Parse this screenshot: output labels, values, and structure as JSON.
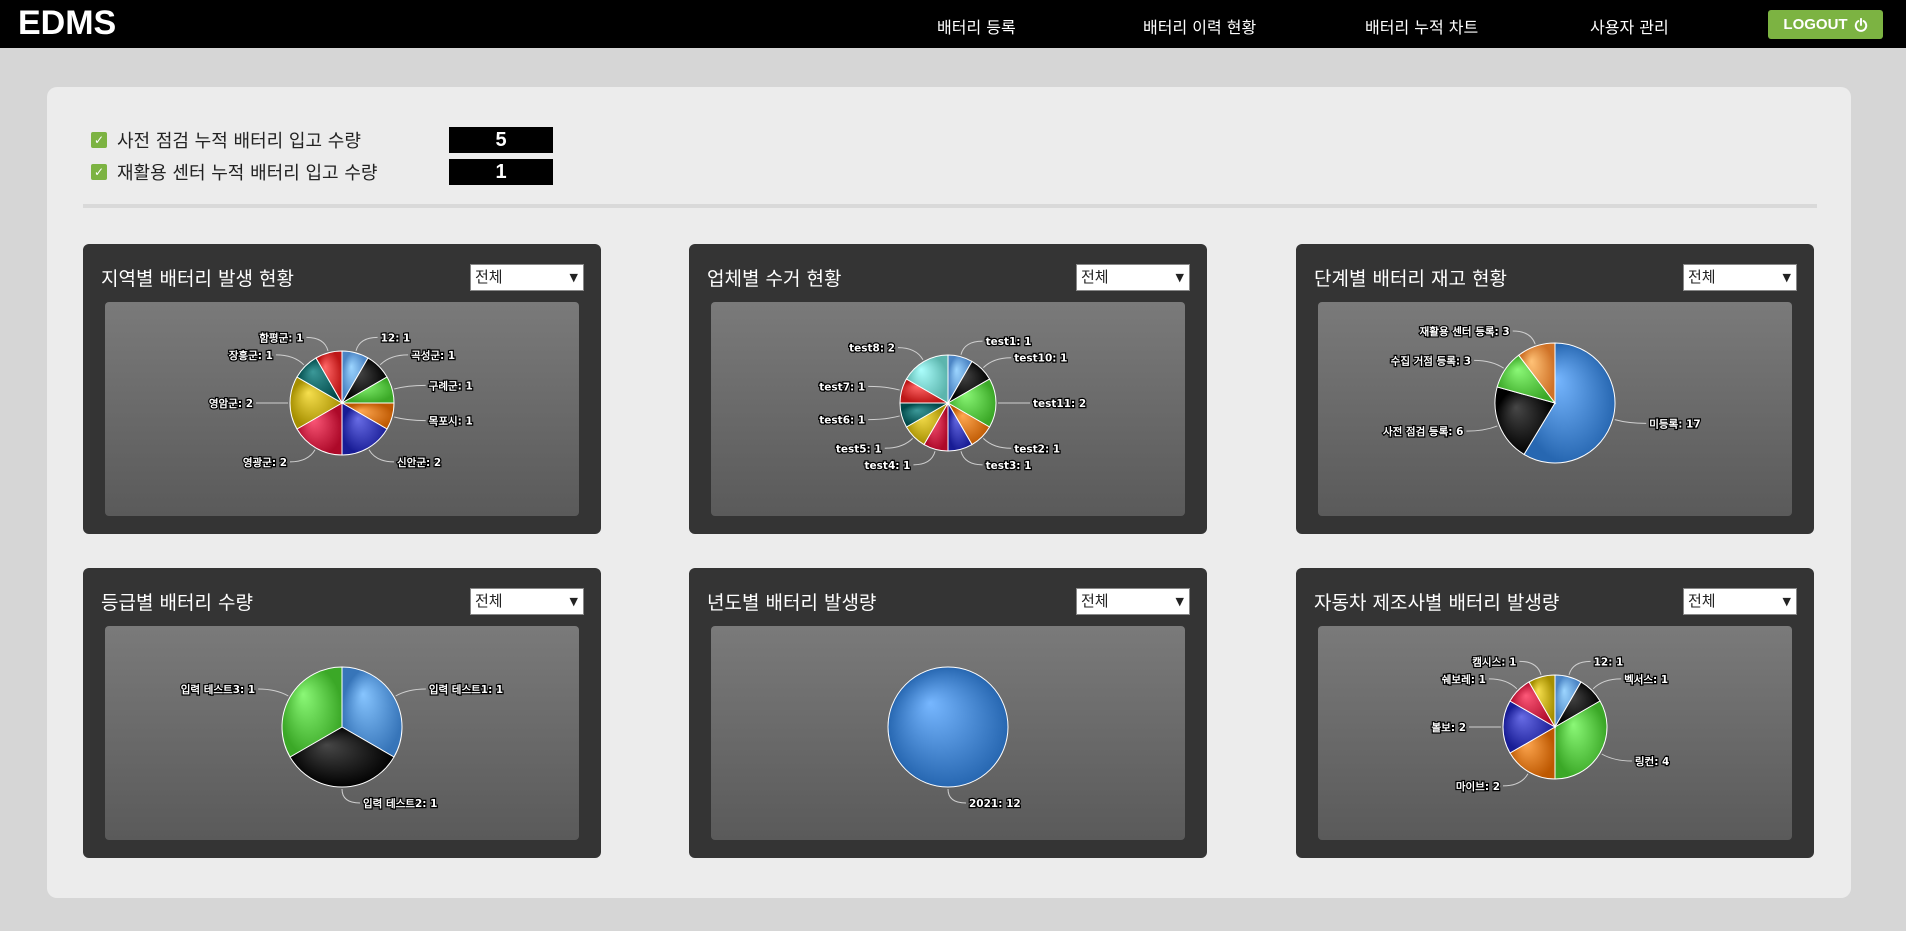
{
  "header": {
    "logo": "EDMS",
    "nav": [
      "배터리 등록",
      "배터리 이력 현황",
      "배터리 누적 차트",
      "사용자 관리"
    ],
    "logout_label": "LOGOUT",
    "accent_color": "#7cb342"
  },
  "stats": [
    {
      "label": "사전 점검 누적 배터리 입고 수량",
      "value": "5",
      "checked": true
    },
    {
      "label": "재활용 센터 누적 배터리 입고 수량",
      "value": "1",
      "checked": true
    }
  ],
  "cards": [
    {
      "title": "지역별 배터리 발생 현황",
      "filter": "전체"
    },
    {
      "title": "업체별 수거 현황",
      "filter": "전체"
    },
    {
      "title": "단계별 배터리 재고 현황",
      "filter": "전체"
    },
    {
      "title": "등급별 배터리 수량",
      "filter": "전체"
    },
    {
      "title": "년도별 배터리 발생량",
      "filter": "전체"
    },
    {
      "title": "자동차 제조사별 배터리 발생량",
      "filter": "전체"
    }
  ],
  "chart_data": [
    {
      "type": "pie",
      "slices": [
        {
          "name": "12",
          "value": 1,
          "color": "#6fa8e8"
        },
        {
          "name": "곡성군",
          "value": 1,
          "color": "#1a1a1a"
        },
        {
          "name": "구례군",
          "value": 1,
          "color": "#5ecb4a"
        },
        {
          "name": "목포시",
          "value": 1,
          "color": "#e07b24"
        },
        {
          "name": "신안군",
          "value": 2,
          "color": "#3b3fb8"
        },
        {
          "name": "영광군",
          "value": 2,
          "color": "#d02c4c"
        },
        {
          "name": "영암군",
          "value": 2,
          "color": "#c9b221"
        },
        {
          "name": "장흥군",
          "value": 1,
          "color": "#0f6c6c"
        },
        {
          "name": "함평군",
          "value": 1,
          "color": "#e03a3a"
        }
      ]
    },
    {
      "type": "pie",
      "slices": [
        {
          "name": "test1",
          "value": 1,
          "color": "#6fa8e8"
        },
        {
          "name": "test10",
          "value": 1,
          "color": "#1a1a1a"
        },
        {
          "name": "test11",
          "value": 2,
          "color": "#5ecb4a"
        },
        {
          "name": "test2",
          "value": 1,
          "color": "#e07b24"
        },
        {
          "name": "test3",
          "value": 1,
          "color": "#3b3fb8"
        },
        {
          "name": "test4",
          "value": 1,
          "color": "#d02c4c"
        },
        {
          "name": "test5",
          "value": 1,
          "color": "#c9b221"
        },
        {
          "name": "test6",
          "value": 1,
          "color": "#0f6c6c"
        },
        {
          "name": "test7",
          "value": 1,
          "color": "#e03a3a"
        },
        {
          "name": "test8",
          "value": 2,
          "color": "#7fd8d0"
        }
      ]
    },
    {
      "type": "pie",
      "slices": [
        {
          "name": "미등록",
          "value": 17,
          "color": "#4a8ad4"
        },
        {
          "name": "사전 점검 등록",
          "value": 6,
          "color": "#1a1a1a"
        },
        {
          "name": "수집 거점 등록",
          "value": 3,
          "color": "#5ecb4a"
        },
        {
          "name": "재활용 센터 등록",
          "value": 3,
          "color": "#f2954a"
        }
      ]
    },
    {
      "type": "pie",
      "slices": [
        {
          "name": "입력 테스트1",
          "value": 1,
          "color": "#5a98dc"
        },
        {
          "name": "입력 테스트2",
          "value": 1,
          "color": "#1a1a1a"
        },
        {
          "name": "입력 테스트3",
          "value": 1,
          "color": "#5ecb4a"
        }
      ]
    },
    {
      "type": "pie",
      "slices": [
        {
          "name": "2021",
          "value": 12,
          "color": "#4a8ad4"
        }
      ]
    },
    {
      "type": "pie",
      "slices": [
        {
          "name": "12",
          "value": 1,
          "color": "#6fa8e8"
        },
        {
          "name": "벡서스",
          "value": 1,
          "color": "#1a1a1a"
        },
        {
          "name": "링컨",
          "value": 4,
          "color": "#5ecb4a"
        },
        {
          "name": "마이브",
          "value": 2,
          "color": "#e07b24"
        },
        {
          "name": "볼보",
          "value": 2,
          "color": "#3b3fb8"
        },
        {
          "name": "쉐보레",
          "value": 1,
          "color": "#d02c4c"
        },
        {
          "name": "캠시스",
          "value": 1,
          "color": "#c9b221"
        }
      ]
    }
  ]
}
